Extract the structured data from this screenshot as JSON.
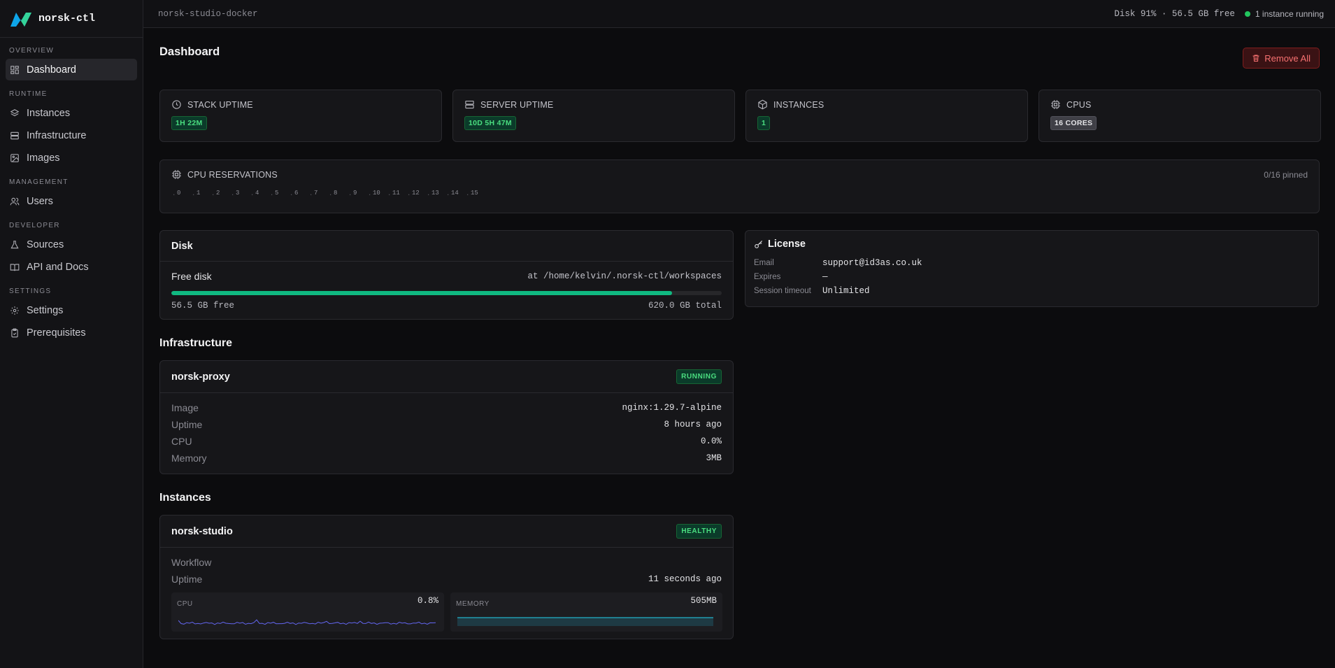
{
  "app": {
    "name": "norsk-ctl"
  },
  "sidebar": {
    "sections": [
      {
        "title": "OVERVIEW",
        "items": [
          {
            "label": "Dashboard",
            "icon": "dashboard-icon",
            "active": true
          }
        ]
      },
      {
        "title": "RUNTIME",
        "items": [
          {
            "label": "Instances",
            "icon": "layers-icon"
          },
          {
            "label": "Infrastructure",
            "icon": "server-icon"
          },
          {
            "label": "Images",
            "icon": "image-icon"
          }
        ]
      },
      {
        "title": "MANAGEMENT",
        "items": [
          {
            "label": "Users",
            "icon": "users-icon"
          }
        ]
      },
      {
        "title": "DEVELOPER",
        "items": [
          {
            "label": "Sources",
            "icon": "flask-icon"
          },
          {
            "label": "API and Docs",
            "icon": "book-icon"
          }
        ]
      },
      {
        "title": "SETTINGS",
        "items": [
          {
            "label": "Settings",
            "icon": "gear-icon"
          },
          {
            "label": "Prerequisites",
            "icon": "clipboard-check-icon"
          }
        ]
      }
    ]
  },
  "topbar": {
    "context": "norsk-studio-docker",
    "disk_status": "Disk 91% · 56.5 GB free",
    "instances_running": "1 instance running"
  },
  "page": {
    "title": "Dashboard",
    "remove_all_label": "Remove All"
  },
  "stats": [
    {
      "label": "STACK UPTIME",
      "value": "1H 22M",
      "icon": "clock-icon",
      "tone": "green"
    },
    {
      "label": "SERVER UPTIME",
      "value": "10D 5H 47M",
      "icon": "server-icon",
      "tone": "green"
    },
    {
      "label": "INSTANCES",
      "value": "1",
      "icon": "box-icon",
      "tone": "green"
    },
    {
      "label": "CPUS",
      "value": "16 CORES",
      "icon": "cpu-icon",
      "tone": "gray"
    }
  ],
  "cpu_reservations": {
    "title": "CPU RESERVATIONS",
    "pinned": "0/16 pinned",
    "cores": [
      "0",
      "1",
      "2",
      "3",
      "4",
      "5",
      "6",
      "7",
      "8",
      "9",
      "10",
      "11",
      "12",
      "13",
      "14",
      "15"
    ]
  },
  "disk": {
    "title": "Disk",
    "label": "Free disk",
    "path": "at /home/kelvin/.norsk-ctl/workspaces",
    "used_fraction": 0.91,
    "free": "56.5 GB free",
    "total": "620.0 GB total"
  },
  "license": {
    "title": "License",
    "rows": [
      {
        "key": "Email",
        "value": "support@id3as.co.uk"
      },
      {
        "key": "Expires",
        "value": "—"
      },
      {
        "key": "Session timeout",
        "value": "Unlimited"
      }
    ]
  },
  "infrastructure": {
    "heading": "Infrastructure",
    "service": {
      "name": "norsk-proxy",
      "status": "RUNNING",
      "rows": [
        {
          "key": "Image",
          "value": "nginx:1.29.7-alpine"
        },
        {
          "key": "Uptime",
          "value": "8 hours ago"
        },
        {
          "key": "CPU",
          "value": "0.0%"
        },
        {
          "key": "Memory",
          "value": "3MB"
        }
      ]
    }
  },
  "instances": {
    "heading": "Instances",
    "instance": {
      "name": "norsk-studio",
      "status": "HEALTHY",
      "rows": [
        {
          "key": "Workflow",
          "value": ""
        },
        {
          "key": "Uptime",
          "value": "11 seconds ago"
        }
      ],
      "cpu": {
        "label": "CPU",
        "value": "0.8%"
      },
      "memory": {
        "label": "MEMORY",
        "value": "505MB"
      }
    }
  },
  "colors": {
    "accent_green": "#10b981",
    "danger": "#f87171",
    "cpu_spark": "#6366f1",
    "memory_spark": "#22d3ee"
  }
}
